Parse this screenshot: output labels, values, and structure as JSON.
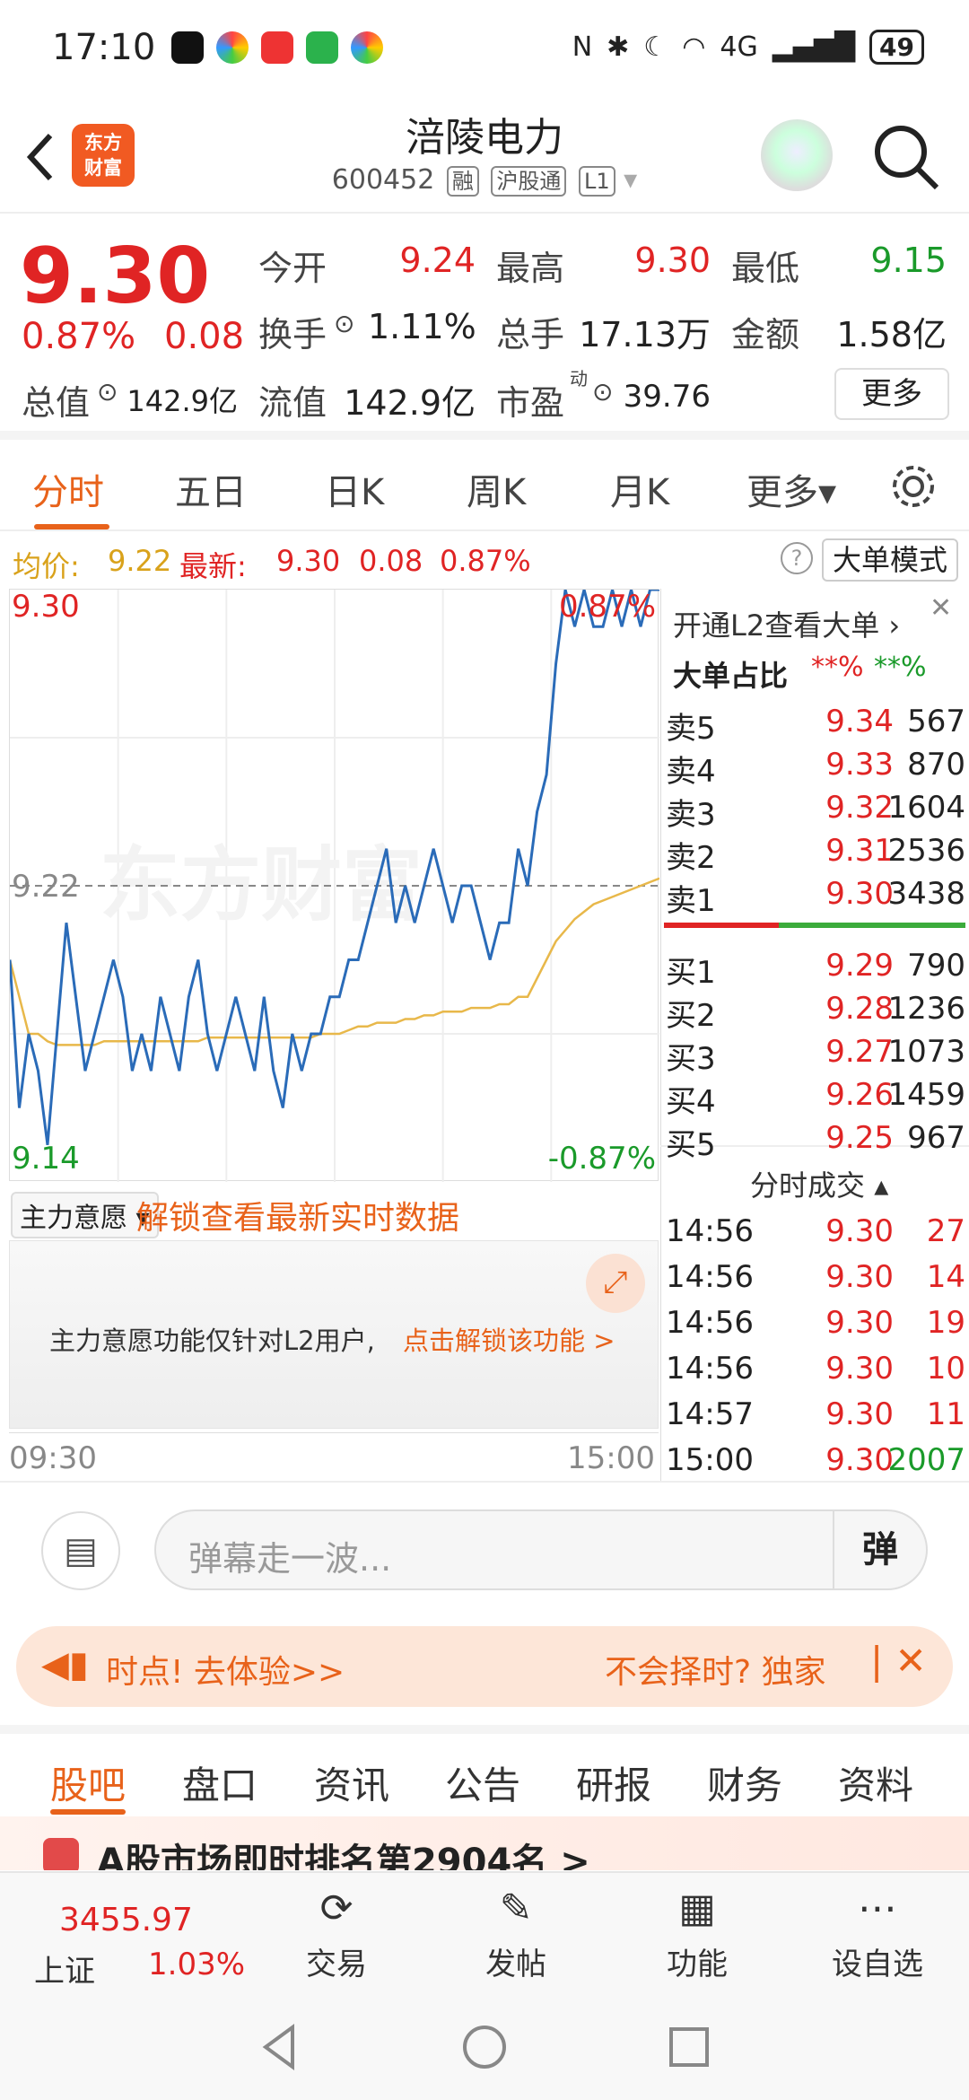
{
  "status": {
    "time": "17:10",
    "battery": "49",
    "network": "4G"
  },
  "header": {
    "title": "涪陵电力",
    "code": "600452",
    "tags": [
      "融",
      "沪股通",
      "L1"
    ],
    "logo_line1": "东方",
    "logo_line2": "财富"
  },
  "quote": {
    "price": "9.30",
    "pct": "0.87%",
    "change": "0.08",
    "open_label": "今开",
    "open": "9.24",
    "high_label": "最高",
    "high": "9.30",
    "low_label": "最低",
    "low": "9.15",
    "turnover_label": "换手",
    "turnover": "1.11%",
    "volume_label": "总手",
    "volume": "17.13万",
    "amount_label": "金额",
    "amount": "1.58亿",
    "mktcap_label": "总值",
    "mktcap": "142.9亿",
    "float_label": "流值",
    "float": "142.9亿",
    "pe_label": "市盈",
    "pe_sup": "动",
    "pe": "39.76",
    "more_label": "更多"
  },
  "tabs": [
    "分时",
    "五日",
    "日K",
    "周K",
    "月K",
    "更多▾"
  ],
  "avgline": {
    "avg_label": "均价:",
    "avg": "9.22",
    "latest_label": "最新:",
    "latest": "9.30",
    "chg": "0.08",
    "pct": "0.87%",
    "mode_label": "大单模式"
  },
  "chart_data": {
    "type": "line",
    "title": "",
    "x_start": "09:30",
    "x_end": "15:00",
    "ylim": [
      9.14,
      9.3
    ],
    "y_mid": "9.22",
    "y_top_label": "9.30",
    "y_bottom_label": "9.14",
    "pct_top": "0.87%",
    "pct_bottom": "-0.87%",
    "series": [
      {
        "name": "最新",
        "values": [
          9.2,
          9.16,
          9.18,
          9.17,
          9.15,
          9.18,
          9.21,
          9.19,
          9.17,
          9.18,
          9.19,
          9.2,
          9.19,
          9.17,
          9.18,
          9.17,
          9.19,
          9.18,
          9.17,
          9.19,
          9.2,
          9.18,
          9.17,
          9.18,
          9.19,
          9.18,
          9.17,
          9.19,
          9.17,
          9.16,
          9.18,
          9.17,
          9.18,
          9.18,
          9.19,
          9.19,
          9.2,
          9.2,
          9.21,
          9.22,
          9.23,
          9.21,
          9.22,
          9.21,
          9.22,
          9.23,
          9.22,
          9.21,
          9.22,
          9.22,
          9.21,
          9.2,
          9.21,
          9.21,
          9.23,
          9.22,
          9.24,
          9.25,
          9.28,
          9.3,
          9.29,
          9.3,
          9.29,
          9.29,
          9.3,
          9.29,
          9.3,
          9.29,
          9.3,
          9.3
        ]
      },
      {
        "name": "均价",
        "values": [
          9.2,
          9.19,
          9.18,
          9.18,
          9.178,
          9.177,
          9.177,
          9.177,
          9.177,
          9.177,
          9.178,
          9.178,
          9.178,
          9.178,
          9.178,
          9.178,
          9.178,
          9.178,
          9.178,
          9.178,
          9.178,
          9.179,
          9.179,
          9.179,
          9.179,
          9.179,
          9.179,
          9.179,
          9.179,
          9.179,
          9.179,
          9.179,
          9.179,
          9.18,
          9.18,
          9.18,
          9.181,
          9.182,
          9.182,
          9.183,
          9.183,
          9.183,
          9.184,
          9.184,
          9.185,
          9.185,
          9.186,
          9.186,
          9.186,
          9.187,
          9.187,
          9.187,
          9.188,
          9.188,
          9.19,
          9.19,
          9.195,
          9.2,
          9.205,
          9.208,
          9.211,
          9.213,
          9.215,
          9.216,
          9.217,
          9.218,
          9.219,
          9.22,
          9.221,
          9.222
        ]
      }
    ]
  },
  "panel": {
    "l2_label": "开通L2查看大单",
    "ratio_label": "大单占比",
    "ratio_sell": "**%",
    "ratio_buy": "**%",
    "asks": [
      {
        "label": "卖5",
        "price": "9.34",
        "vol": "567"
      },
      {
        "label": "卖4",
        "price": "9.33",
        "vol": "870"
      },
      {
        "label": "卖3",
        "price": "9.32",
        "vol": "1604"
      },
      {
        "label": "卖2",
        "price": "9.31",
        "vol": "2536"
      },
      {
        "label": "卖1",
        "price": "9.30",
        "vol": "3438"
      }
    ],
    "bids": [
      {
        "label": "买1",
        "price": "9.29",
        "vol": "790"
      },
      {
        "label": "买2",
        "price": "9.28",
        "vol": "1236"
      },
      {
        "label": "买3",
        "price": "9.27",
        "vol": "1073"
      },
      {
        "label": "买4",
        "price": "9.26",
        "vol": "1459"
      },
      {
        "label": "买5",
        "price": "9.25",
        "vol": "967"
      }
    ],
    "trades_label": "分时成交",
    "trades": [
      {
        "time": "14:56",
        "price": "9.30",
        "vol": "27"
      },
      {
        "time": "14:56",
        "price": "9.30",
        "vol": "14"
      },
      {
        "time": "14:56",
        "price": "9.30",
        "vol": "19"
      },
      {
        "time": "14:56",
        "price": "9.30",
        "vol": "10"
      },
      {
        "time": "14:57",
        "price": "9.30",
        "vol": "11"
      },
      {
        "time": "15:00",
        "price": "9.30",
        "vol": "2007"
      }
    ]
  },
  "zhuli": {
    "select_label": "主力意愿",
    "unlock_label": "解锁查看最新实时数据",
    "info": "主力意愿功能仅针对L2用户,",
    "link": "点击解锁该功能 >"
  },
  "danmu": {
    "placeholder": "弹幕走一波...",
    "send_label": "弹"
  },
  "banner": {
    "left_text": "时点!  去体验>>",
    "right_text": "不会择时? 独家"
  },
  "sectabs": [
    "股吧",
    "盘口",
    "资讯",
    "公告",
    "研报",
    "财务",
    "资料"
  ],
  "news": {
    "text": "A股市场即时排名第2904名 >"
  },
  "bottomnav": {
    "index_value": "3455.97",
    "index_name": "上证",
    "index_pct": "1.03%",
    "items": [
      "交易",
      "发帖",
      "功能",
      "设自选"
    ]
  }
}
